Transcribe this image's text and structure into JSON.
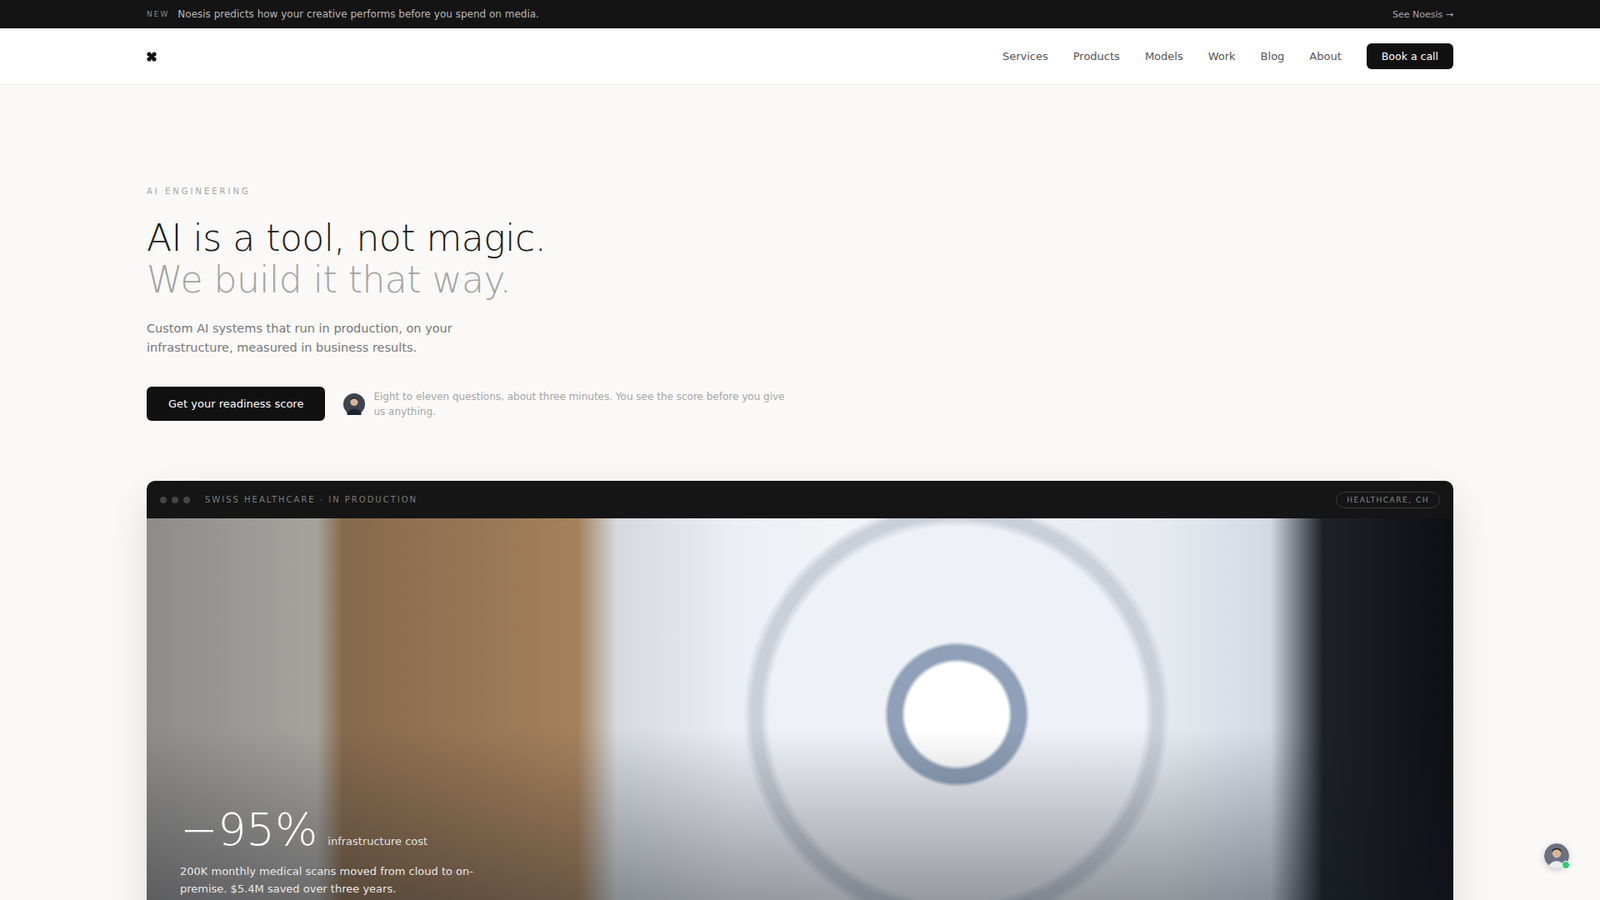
{
  "announcement": {
    "badge": "NEW",
    "text": "Noesis predicts how your creative performs before you spend on media.",
    "link": "See Noesis →"
  },
  "nav": {
    "links": [
      "Services",
      "Products",
      "Models",
      "Work",
      "Blog",
      "About"
    ],
    "cta": "Book a call"
  },
  "hero": {
    "eyebrow": "AI ENGINEERING",
    "title": "AI is a tool, not magic.",
    "subtitle": "We build it that way.",
    "description": "Custom AI systems that run in production, on your infrastructure, measured in business results.",
    "cta": "Get your readiness score",
    "note": "Eight to eleven questions, about three minutes. You see the score before you give us anything."
  },
  "case_study": {
    "label": "SWISS HEALTHCARE · IN PRODUCTION",
    "tag": "HEALTHCARE, CH",
    "stat": "−95%",
    "stat_label": "infrastructure cost",
    "summary": "200K monthly medical scans moved from cloud to on-premise. $5.4M saved over three years."
  },
  "chat": {
    "online": true
  }
}
